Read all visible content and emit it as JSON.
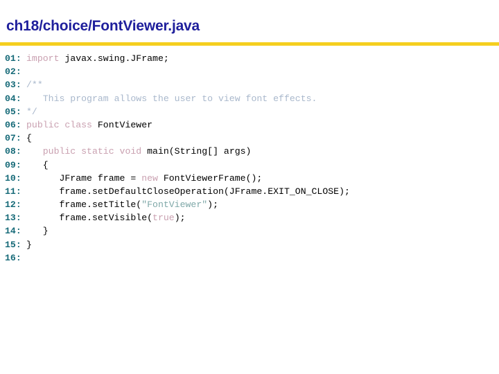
{
  "slide": {
    "title": "ch18/choice/FontViewer.java",
    "title_color": "#1f1f9c",
    "rule_color": "#f5cf1f",
    "background_color": "#ffffff"
  },
  "syntax_colors": {
    "lineno": "#166a78",
    "plain": "#000000",
    "keyword": "#c9a0b0",
    "comment": "#a9b8cc",
    "string": "#7fa8a8"
  },
  "code": {
    "lines": [
      {
        "number": "01:",
        "tokens": [
          {
            "text": "import ",
            "type": "keyword"
          },
          {
            "text": "javax.swing.JFrame;",
            "type": "plain"
          }
        ]
      },
      {
        "number": "02:",
        "tokens": []
      },
      {
        "number": "03:",
        "tokens": [
          {
            "text": "/**",
            "type": "comment"
          }
        ]
      },
      {
        "number": "04:",
        "tokens": [
          {
            "text": "   This program allows the user to view font effects.",
            "type": "comment"
          }
        ]
      },
      {
        "number": "05:",
        "tokens": [
          {
            "text": "*/",
            "type": "comment"
          }
        ]
      },
      {
        "number": "06:",
        "tokens": [
          {
            "text": "public class ",
            "type": "keyword"
          },
          {
            "text": "FontViewer",
            "type": "plain"
          }
        ]
      },
      {
        "number": "07:",
        "tokens": [
          {
            "text": "{",
            "type": "plain"
          }
        ]
      },
      {
        "number": "08:",
        "tokens": [
          {
            "text": "   public static void ",
            "type": "keyword"
          },
          {
            "text": "main(String[] args)",
            "type": "plain"
          }
        ]
      },
      {
        "number": "09:",
        "tokens": [
          {
            "text": "   {",
            "type": "plain"
          }
        ]
      },
      {
        "number": "10:",
        "tokens": [
          {
            "text": "      JFrame frame = ",
            "type": "plain"
          },
          {
            "text": "new ",
            "type": "keyword"
          },
          {
            "text": "FontViewerFrame();",
            "type": "plain"
          }
        ]
      },
      {
        "number": "11:",
        "tokens": [
          {
            "text": "      frame.setDefaultCloseOperation(JFrame.EXIT_ON_CLOSE);",
            "type": "plain"
          }
        ]
      },
      {
        "number": "12:",
        "tokens": [
          {
            "text": "      frame.setTitle(",
            "type": "plain"
          },
          {
            "text": "\"FontViewer\"",
            "type": "string"
          },
          {
            "text": ");",
            "type": "plain"
          }
        ]
      },
      {
        "number": "13:",
        "tokens": [
          {
            "text": "      frame.setVisible(",
            "type": "plain"
          },
          {
            "text": "true",
            "type": "keyword"
          },
          {
            "text": ");",
            "type": "plain"
          }
        ]
      },
      {
        "number": "14:",
        "tokens": [
          {
            "text": "   }",
            "type": "plain"
          }
        ]
      },
      {
        "number": "15:",
        "tokens": [
          {
            "text": "}",
            "type": "plain"
          }
        ]
      },
      {
        "number": "16:",
        "tokens": []
      }
    ]
  }
}
